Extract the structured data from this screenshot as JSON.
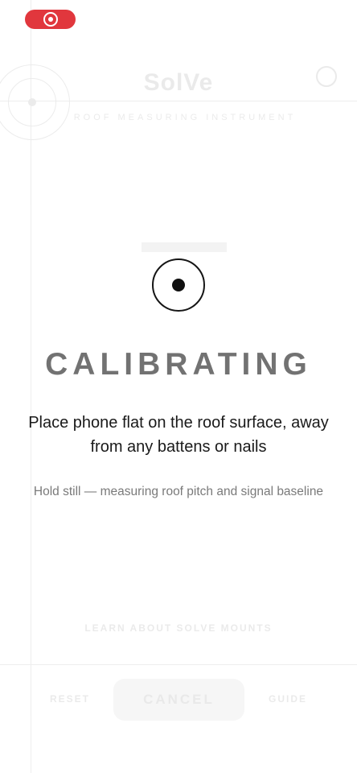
{
  "app": {
    "logo": "SolVe",
    "subtitle": "ROOF MEASURING INSTRUMENT",
    "learn_link": "LEARN ABOUT SOLVE MOUNTS",
    "reset_label": "RESET",
    "guide_label": "GUIDE"
  },
  "status": {
    "icon": "record-icon",
    "color": "#e1373d"
  },
  "calibration": {
    "icon": "target-icon",
    "title": "CALIBRATING",
    "instruction": "Place phone flat on the roof surface, away from any battens or nails",
    "subtext": "Hold still — measuring roof pitch and signal baseline",
    "cancel_label": "CANCEL"
  }
}
